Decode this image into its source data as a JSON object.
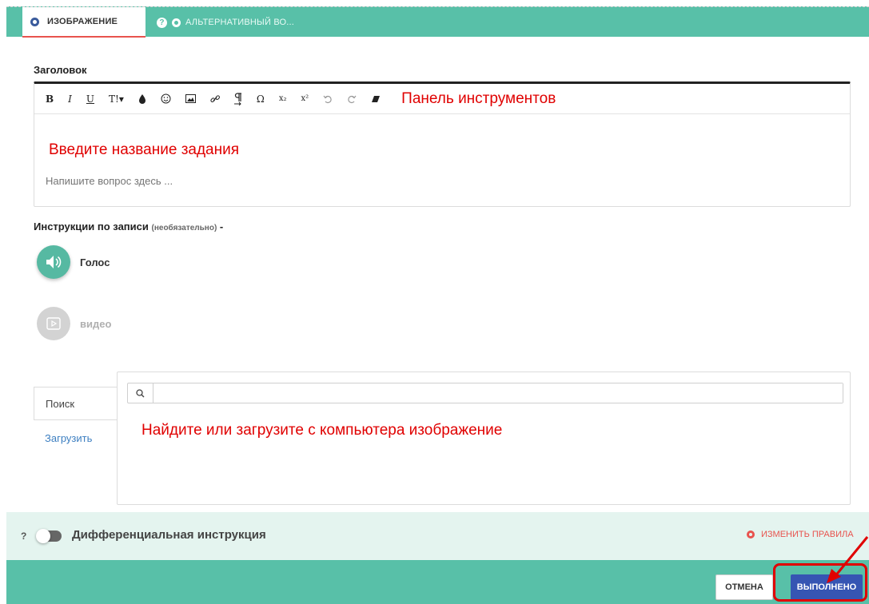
{
  "tabs": [
    {
      "label": "ИЗОБРАЖЕНИЕ",
      "active": true
    },
    {
      "label": "АЛЬТЕРНАТИВНЫЙ ВО...",
      "active": false
    }
  ],
  "title_section": {
    "label": "Заголовок",
    "toolbar": {
      "buttons": [
        "B",
        "I",
        "U",
        "T!▾",
        "color-icon",
        "emoji-icon",
        "image-icon",
        "link-icon",
        "paragraph-icon",
        "Ω",
        "x₂",
        "x²",
        "undo-icon",
        "redo-icon",
        "eraser-icon"
      ],
      "annotation": "Панель инструментов"
    },
    "annotation": "Введите название задания",
    "placeholder": "Напишите вопрос здесь ..."
  },
  "instructions": {
    "label": "Инструкции по записи",
    "optional": "(необязательно)",
    "suffix": "-",
    "voice_label": "Голос",
    "video_label": "видео"
  },
  "image_panel": {
    "search_tab": "Поиск",
    "upload_tab": "Загрузить",
    "annotation": "Найдите или загрузите с компьютера изображение"
  },
  "differential": {
    "help": "?",
    "label": "Дифференциальная инструкция",
    "rules_link": "ИЗМЕНИТЬ ПРАВИЛА"
  },
  "footer": {
    "cancel_label": "ОТМЕНА",
    "done_label": "ВЫПОЛНЕНО"
  },
  "colors": {
    "accent_green": "#58c0a8",
    "annotation_red": "#e00000",
    "primary_blue": "#3655b3",
    "link_red": "#e8534e"
  }
}
